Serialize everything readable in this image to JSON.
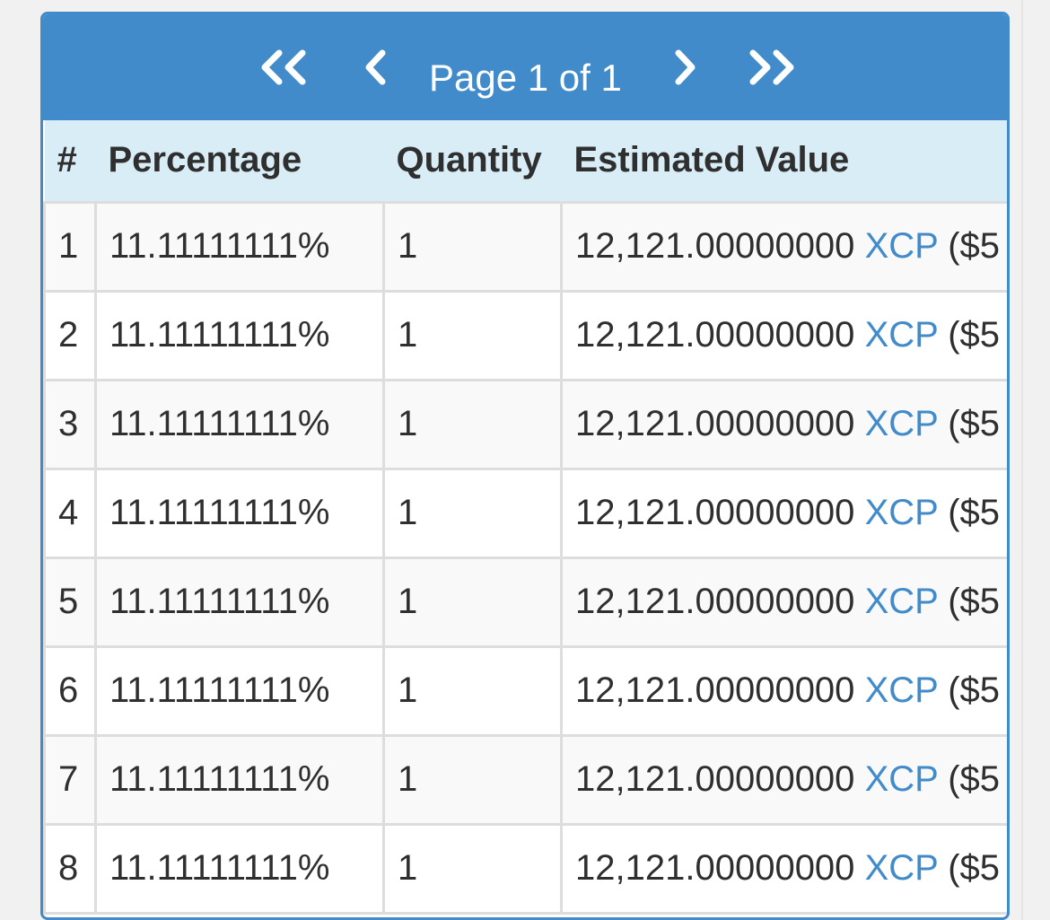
{
  "pager": {
    "page_label": "Page 1 of 1",
    "first_icon": "double-chevron-left",
    "prev_icon": "chevron-left",
    "next_icon": "chevron-right",
    "last_icon": "double-chevron-right"
  },
  "table": {
    "headers": [
      "#",
      "Percentage",
      "Quantity",
      "Estimated Value"
    ],
    "rows": [
      {
        "num": "1",
        "percentage": "11.11111111%",
        "quantity": "1",
        "value": "12,121.00000000",
        "asset": "XCP",
        "usd": "($5"
      },
      {
        "num": "2",
        "percentage": "11.11111111%",
        "quantity": "1",
        "value": "12,121.00000000",
        "asset": "XCP",
        "usd": "($5"
      },
      {
        "num": "3",
        "percentage": "11.11111111%",
        "quantity": "1",
        "value": "12,121.00000000",
        "asset": "XCP",
        "usd": "($5"
      },
      {
        "num": "4",
        "percentage": "11.11111111%",
        "quantity": "1",
        "value": "12,121.00000000",
        "asset": "XCP",
        "usd": "($5"
      },
      {
        "num": "5",
        "percentage": "11.11111111%",
        "quantity": "1",
        "value": "12,121.00000000",
        "asset": "XCP",
        "usd": "($5"
      },
      {
        "num": "6",
        "percentage": "11.11111111%",
        "quantity": "1",
        "value": "12,121.00000000",
        "asset": "XCP",
        "usd": "($5"
      },
      {
        "num": "7",
        "percentage": "11.11111111%",
        "quantity": "1",
        "value": "12,121.00000000",
        "asset": "XCP",
        "usd": "($5"
      },
      {
        "num": "8",
        "percentage": "11.11111111%",
        "quantity": "1",
        "value": "12,121.00000000",
        "asset": "XCP",
        "usd": "($5"
      }
    ]
  },
  "colors": {
    "primary": "#428bca",
    "header_bg": "#d9edf7",
    "text": "#2f2f2f"
  }
}
